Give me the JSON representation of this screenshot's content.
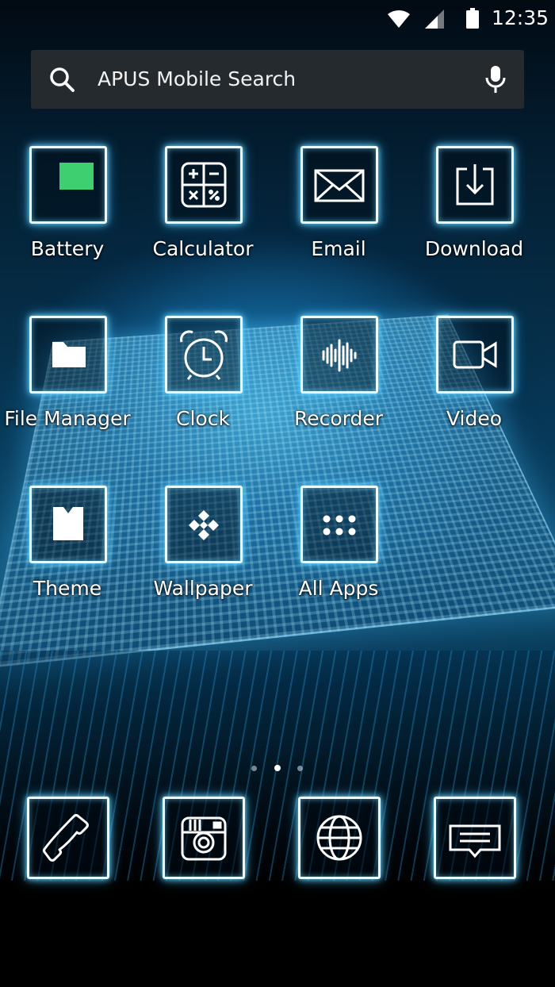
{
  "status_bar": {
    "time": "12:35",
    "icons": [
      "wifi-icon",
      "cell-signal-icon",
      "battery-icon"
    ]
  },
  "search": {
    "placeholder": "APUS Mobile Search",
    "icon": "search-icon",
    "voice_icon": "microphone-icon"
  },
  "apps": [
    {
      "label": "Battery",
      "icon": "battery-level-icon"
    },
    {
      "label": "Calculator",
      "icon": "calculator-icon"
    },
    {
      "label": "Email",
      "icon": "envelope-icon"
    },
    {
      "label": "Download",
      "icon": "download-icon"
    },
    {
      "label": "File Manager",
      "icon": "folder-icon"
    },
    {
      "label": "Clock",
      "icon": "alarm-clock-icon"
    },
    {
      "label": "Recorder",
      "icon": "sound-wave-icon"
    },
    {
      "label": "Video",
      "icon": "video-camera-icon"
    },
    {
      "label": "Theme",
      "icon": "shirt-icon"
    },
    {
      "label": "Wallpaper",
      "icon": "diamond-grid-icon"
    },
    {
      "label": "All Apps",
      "icon": "app-grid-icon"
    }
  ],
  "page_indicator": {
    "pages": 3,
    "current": 2
  },
  "dock": [
    {
      "icon": "phone-icon"
    },
    {
      "icon": "camera-icon"
    },
    {
      "icon": "globe-icon"
    },
    {
      "icon": "message-icon"
    }
  ],
  "colors": {
    "icon_glow": "#78dcff",
    "battery_fill": "#3ecf70",
    "search_bg": "#282c30"
  }
}
